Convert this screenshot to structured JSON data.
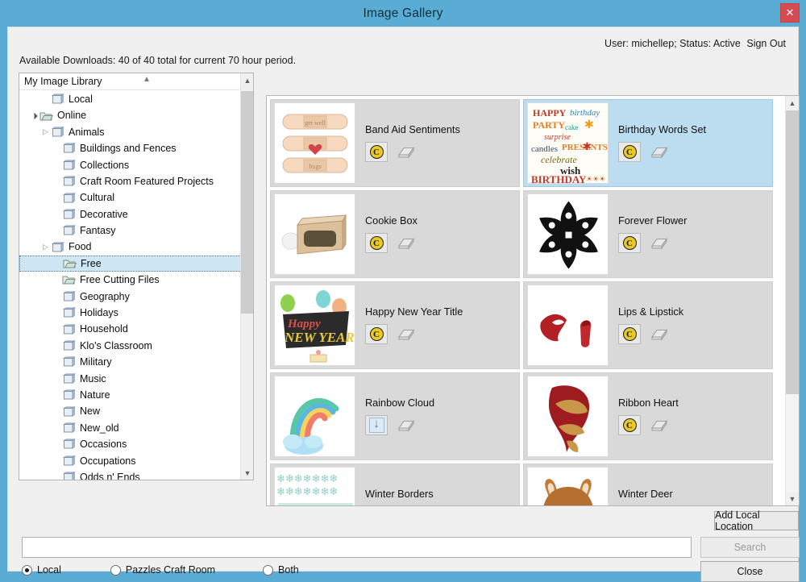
{
  "window": {
    "title": "Image Gallery",
    "close_label": "✕",
    "accent_color": "#5bacd4",
    "close_color": "#d64a52"
  },
  "header": {
    "user_text": "User: michellep; Status: Active",
    "sign_out_label": "Sign Out",
    "downloads_text": "Available Downloads: 40 of 40 total for current 70 hour period."
  },
  "tree": {
    "header_label": "My Image Library",
    "items": [
      {
        "label": "Local",
        "indent": 1,
        "expander": "",
        "icon": "folder-icon",
        "selected": false
      },
      {
        "label": "Online",
        "indent": 0,
        "expander": "open",
        "icon": "folder-open-icon",
        "selected": false
      },
      {
        "label": "Animals",
        "indent": 1,
        "expander": "closed",
        "icon": "folder-icon",
        "selected": false
      },
      {
        "label": "Buildings and Fences",
        "indent": 2,
        "expander": "",
        "icon": "folder-icon",
        "selected": false
      },
      {
        "label": "Collections",
        "indent": 2,
        "expander": "",
        "icon": "folder-icon",
        "selected": false
      },
      {
        "label": "Craft Room Featured Projects",
        "indent": 2,
        "expander": "",
        "icon": "folder-icon",
        "selected": false
      },
      {
        "label": "Cultural",
        "indent": 2,
        "expander": "",
        "icon": "folder-icon",
        "selected": false
      },
      {
        "label": "Decorative",
        "indent": 2,
        "expander": "",
        "icon": "folder-icon",
        "selected": false
      },
      {
        "label": "Fantasy",
        "indent": 2,
        "expander": "",
        "icon": "folder-icon",
        "selected": false
      },
      {
        "label": "Food",
        "indent": 1,
        "expander": "closed",
        "icon": "folder-icon",
        "selected": false
      },
      {
        "label": "Free",
        "indent": 2,
        "expander": "",
        "icon": "folder-open-icon",
        "selected": true
      },
      {
        "label": "Free Cutting Files",
        "indent": 2,
        "expander": "",
        "icon": "folder-open-icon",
        "selected": false
      },
      {
        "label": "Geography",
        "indent": 2,
        "expander": "",
        "icon": "folder-icon",
        "selected": false
      },
      {
        "label": "Holidays",
        "indent": 2,
        "expander": "",
        "icon": "folder-icon",
        "selected": false
      },
      {
        "label": "Household",
        "indent": 2,
        "expander": "",
        "icon": "folder-icon",
        "selected": false
      },
      {
        "label": "Klo's Classroom",
        "indent": 2,
        "expander": "",
        "icon": "folder-icon",
        "selected": false
      },
      {
        "label": "Military",
        "indent": 2,
        "expander": "",
        "icon": "folder-icon",
        "selected": false
      },
      {
        "label": "Music",
        "indent": 2,
        "expander": "",
        "icon": "folder-icon",
        "selected": false
      },
      {
        "label": "Nature",
        "indent": 2,
        "expander": "",
        "icon": "folder-icon",
        "selected": false
      },
      {
        "label": "New",
        "indent": 2,
        "expander": "",
        "icon": "folder-icon",
        "selected": false
      },
      {
        "label": "New_old",
        "indent": 2,
        "expander": "",
        "icon": "folder-icon",
        "selected": false
      },
      {
        "label": "Occasions",
        "indent": 2,
        "expander": "",
        "icon": "folder-icon",
        "selected": false
      },
      {
        "label": "Occupations",
        "indent": 2,
        "expander": "",
        "icon": "folder-icon",
        "selected": false
      },
      {
        "label": "Odds n' Ends",
        "indent": 2,
        "expander": "",
        "icon": "folder-icon",
        "selected": false
      }
    ]
  },
  "gallery": {
    "items": [
      {
        "title": "Band Aid Sentiments",
        "thumb": "bandaid",
        "action": "credit",
        "cut": true,
        "selected": false
      },
      {
        "title": "Birthday Words Set",
        "thumb": "birthday",
        "action": "credit",
        "cut": true,
        "selected": true
      },
      {
        "title": "Cookie Box",
        "thumb": "cookiebox",
        "action": "credit",
        "cut": true,
        "selected": false
      },
      {
        "title": "Forever Flower",
        "thumb": "flower",
        "action": "credit",
        "cut": true,
        "selected": false
      },
      {
        "title": "Happy New Year Title",
        "thumb": "newyear",
        "action": "credit",
        "cut": true,
        "selected": false
      },
      {
        "title": "Lips & Lipstick",
        "thumb": "lips",
        "action": "credit",
        "cut": true,
        "selected": false
      },
      {
        "title": "Rainbow Cloud",
        "thumb": "rainbow",
        "action": "download",
        "cut": true,
        "selected": false
      },
      {
        "title": "Ribbon Heart",
        "thumb": "ribbon",
        "action": "credit",
        "cut": true,
        "selected": false
      },
      {
        "title": "Winter Borders",
        "thumb": "borders",
        "action": "credit",
        "cut": true,
        "selected": false
      },
      {
        "title": "Winter Deer",
        "thumb": "deer",
        "action": "credit",
        "cut": true,
        "selected": false
      }
    ],
    "credit_glyph": "C"
  },
  "controls": {
    "add_local_label": "Add Local Location",
    "search_value": "",
    "search_placeholder": "",
    "search_label": "Search",
    "search_enabled": false,
    "close_label": "Close",
    "radios": [
      {
        "label": "Local",
        "checked": true
      },
      {
        "label": "Pazzles Craft Room",
        "checked": false
      },
      {
        "label": "Both",
        "checked": false
      }
    ]
  }
}
